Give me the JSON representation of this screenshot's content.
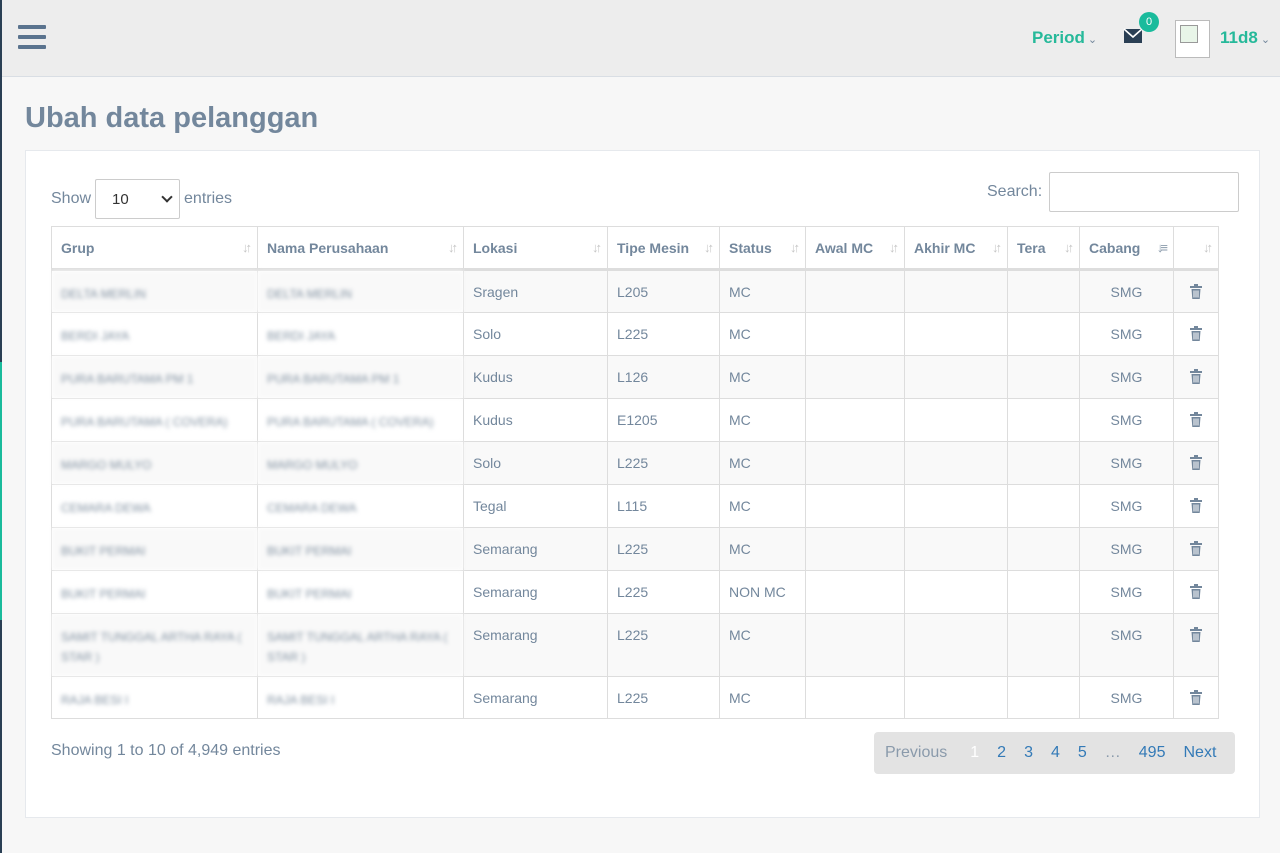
{
  "topbar": {
    "period_label": "Period",
    "mail_count": "0",
    "user_name": "11d8"
  },
  "page": {
    "title": "Ubah data pelanggan"
  },
  "controls": {
    "show_label": "Show",
    "page_length": "10",
    "entries_label": "entries",
    "search_label": "Search:"
  },
  "table": {
    "headers": [
      "Grup",
      "Nama Perusahaan",
      "Lokasi",
      "Tipe Mesin",
      "Status",
      "Awal MC",
      "Akhir MC",
      "Tera",
      "Cabang",
      ""
    ],
    "rows": [
      {
        "grup": "DELTA MERLIN",
        "nama": "DELTA MERLIN",
        "lokasi": "Sragen",
        "tipe": "L205",
        "status": "MC",
        "awal": "",
        "akhir": "",
        "tera": "",
        "cabang": "SMG"
      },
      {
        "grup": "BERDI JAYA",
        "nama": "BERDI JAYA",
        "lokasi": "Solo",
        "tipe": "L225",
        "status": "MC",
        "awal": "",
        "akhir": "",
        "tera": "",
        "cabang": "SMG"
      },
      {
        "grup": "PURA BARUTAMA PM 1",
        "nama": "PURA BARUTAMA PM 1",
        "lokasi": "Kudus",
        "tipe": "L126",
        "status": "MC",
        "awal": "",
        "akhir": "",
        "tera": "",
        "cabang": "SMG"
      },
      {
        "grup": "PURA BARUTAMA ( COVERA)",
        "nama": "PURA BARUTAMA ( COVERA)",
        "lokasi": "Kudus",
        "tipe": "E1205",
        "status": "MC",
        "awal": "",
        "akhir": "",
        "tera": "",
        "cabang": "SMG"
      },
      {
        "grup": "MARGO MULYO",
        "nama": "MARGO MULYO",
        "lokasi": "Solo",
        "tipe": "L225",
        "status": "MC",
        "awal": "",
        "akhir": "",
        "tera": "",
        "cabang": "SMG"
      },
      {
        "grup": "CEMARA DEWA",
        "nama": "CEMARA DEWA",
        "lokasi": "Tegal",
        "tipe": "L115",
        "status": "MC",
        "awal": "",
        "akhir": "",
        "tera": "",
        "cabang": "SMG"
      },
      {
        "grup": "BUKIT PERMAI",
        "nama": "BUKIT PERMAI",
        "lokasi": "Semarang",
        "tipe": "L225",
        "status": "MC",
        "awal": "",
        "akhir": "",
        "tera": "",
        "cabang": "SMG"
      },
      {
        "grup": "BUKIT PERMAI",
        "nama": "BUKIT PERMAI",
        "lokasi": "Semarang",
        "tipe": "L225",
        "status": "NON MC",
        "awal": "",
        "akhir": "",
        "tera": "",
        "cabang": "SMG"
      },
      {
        "grup": "SAMIT TUNGGAL ARTHA RAYA ( STAR )",
        "nama": "SAMIT TUNGGAL ARTHA RAYA ( STAR )",
        "lokasi": "Semarang",
        "tipe": "L225",
        "status": "MC",
        "awal": "",
        "akhir": "",
        "tera": "",
        "cabang": "SMG"
      },
      {
        "grup": "RAJA BESI I",
        "nama": "RAJA BESI I",
        "lokasi": "Semarang",
        "tipe": "L225",
        "status": "MC",
        "awal": "",
        "akhir": "",
        "tera": "",
        "cabang": "SMG"
      }
    ]
  },
  "footer": {
    "info": "Showing 1 to 10 of 4,949 entries",
    "pagination": {
      "previous": "Previous",
      "pages": [
        "1",
        "2",
        "3",
        "4",
        "5",
        "…",
        "495"
      ],
      "next": "Next"
    }
  },
  "colors": {
    "accent": "#26b99a",
    "text": "#73879c",
    "link": "#337ab7"
  }
}
